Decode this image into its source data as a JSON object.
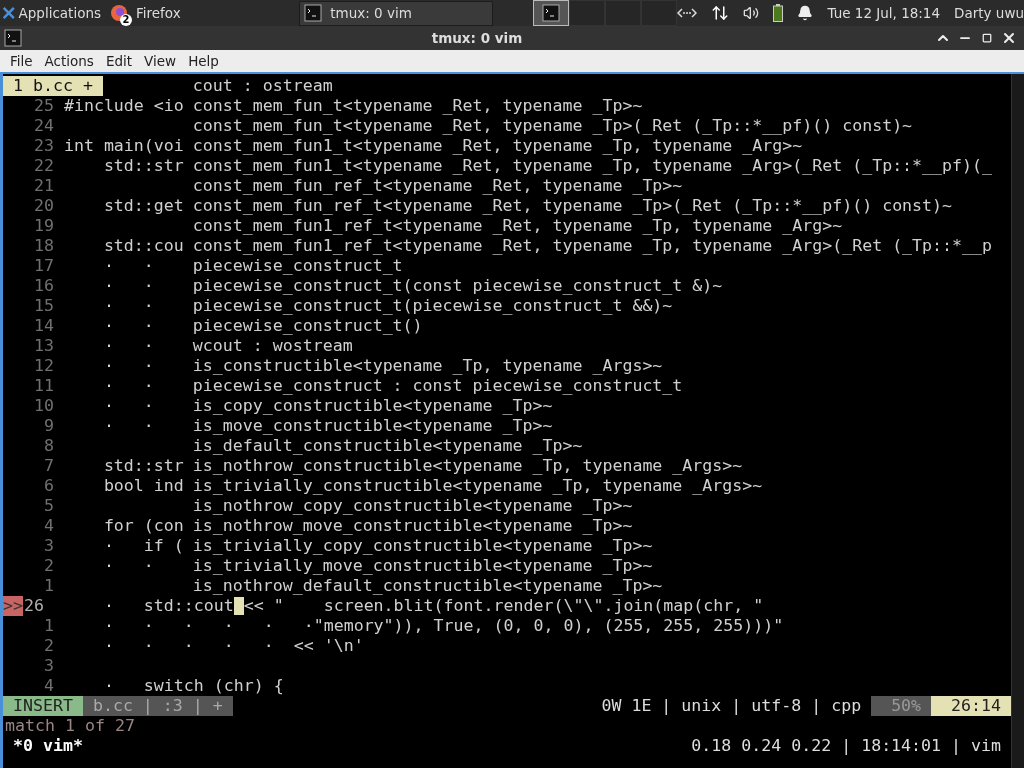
{
  "taskbar": {
    "menu_label": "Applications",
    "tasks": [
      {
        "label": "Firefox",
        "badge": "2",
        "kind": "browser",
        "selected": false
      },
      {
        "label": "tmux: 0 vim",
        "kind": "terminal",
        "selected": true
      }
    ],
    "workspaces": [
      {
        "selected": true
      },
      {
        "selected": false
      },
      {
        "selected": false
      },
      {
        "selected": false
      }
    ],
    "clock": "Tue 12 Jul, 18:14",
    "user": "Darty uwu"
  },
  "window": {
    "title": "tmux: 0 vim"
  },
  "menu": [
    "File",
    "Actions",
    "Edit",
    "View",
    "Help"
  ],
  "vim": {
    "tab": "1 b.cc +",
    "lines": [
      {
        "num": "25",
        "code": "#include <io",
        "current": false
      },
      {
        "num": "24",
        "current": false
      },
      {
        "num": "23",
        "code": "int main(voi",
        "current": false
      },
      {
        "num": "22",
        "code": "    std::str",
        "current": false
      },
      {
        "num": "21",
        "current": false
      },
      {
        "num": "20",
        "code": "    std::get",
        "current": false
      },
      {
        "num": "19",
        "current": false
      },
      {
        "num": "18",
        "code": "    std::cou",
        "current": false
      },
      {
        "num": "17",
        "code": "    ·   ·",
        "current": false
      },
      {
        "num": "16",
        "code": "    ·   ·",
        "current": false
      },
      {
        "num": "15",
        "code": "    ·   ·",
        "current": false
      },
      {
        "num": "14",
        "code": "    ·   ·",
        "current": false
      },
      {
        "num": "13",
        "code": "    ·   ·",
        "current": false
      },
      {
        "num": "12",
        "code": "    ·   ·",
        "current": false
      },
      {
        "num": "11",
        "code": "    ·   ·",
        "current": false
      },
      {
        "num": "10",
        "code": "    ·   ·",
        "current": false
      },
      {
        "num": "9",
        "code": "    ·   ·",
        "current": false
      },
      {
        "num": "8",
        "current": false
      },
      {
        "num": "7",
        "code": "    std::str",
        "current": false
      },
      {
        "num": "6",
        "code": "    bool ind",
        "current": false
      },
      {
        "num": "5",
        "current": false
      },
      {
        "num": "4",
        "code": "    for (con",
        "current": false
      },
      {
        "num": "3",
        "code": "    ·   if (",
        "current": false
      },
      {
        "num": "2",
        "code": "    ·   ·",
        "current": false
      },
      {
        "num": "1",
        "current": false
      },
      {
        "num": "26",
        "sign": ">>",
        "code": "    ·   std::cout",
        "after": "<< \"    screen.blit(font.render(\\\"\\\".join(map(chr, \"",
        "current": true
      },
      {
        "num": "1",
        "code": "    ·   ·   ·   ·   ·   ·\"memory\")), True, (0, 0, 0), (255, 255, 255)))\"",
        "current": false
      },
      {
        "num": "2",
        "code": "    ·   ·   ·   ·   ·  << '\\n'",
        "current": false
      },
      {
        "num": "3",
        "current": false
      },
      {
        "num": "4",
        "code": "    ·   switch (chr) {",
        "current": false
      }
    ],
    "completions": [
      "cout : ostream",
      "const_mem_fun_t<typename _Ret, typename _Tp>~",
      "const_mem_fun_t<typename _Ret, typename _Tp>(_Ret (_Tp::*__pf)() const)~",
      "const_mem_fun1_t<typename _Ret, typename _Tp, typename _Arg>~",
      "const_mem_fun1_t<typename _Ret, typename _Tp, typename _Arg>(_Ret (_Tp::*__pf)(_",
      "const_mem_fun_ref_t<typename _Ret, typename _Tp>~",
      "const_mem_fun_ref_t<typename _Ret, typename _Tp>(_Ret (_Tp::*__pf)() const)~",
      "const_mem_fun1_ref_t<typename _Ret, typename _Tp, typename _Arg>~",
      "const_mem_fun1_ref_t<typename _Ret, typename _Tp, typename _Arg>(_Ret (_Tp::*__p",
      "piecewise_construct_t",
      "piecewise_construct_t(const piecewise_construct_t &)~",
      "piecewise_construct_t(piecewise_construct_t &&)~",
      "piecewise_construct_t()",
      "wcout : wostream",
      "is_constructible<typename _Tp, typename _Args>~",
      "piecewise_construct : const piecewise_construct_t",
      "is_copy_constructible<typename _Tp>~",
      "is_move_constructible<typename _Tp>~",
      "is_default_constructible<typename _Tp>~",
      "is_nothrow_constructible<typename _Tp, typename _Args>~",
      "is_trivially_constructible<typename _Tp, typename _Args>~",
      "is_nothrow_copy_constructible<typename _Tp>~",
      "is_nothrow_move_constructible<typename _Tp>~",
      "is_trivially_copy_constructible<typename _Tp>~",
      "is_trivially_move_constructible<typename _Tp>~",
      "is_nothrow_default_constructible<typename _Tp>~"
    ],
    "statusline": {
      "mode": "INSERT",
      "file": "b.cc | :3 | +",
      "info": "0W 1E | unix | utf-8 | cpp",
      "percent": "50%",
      "position": "26:14"
    },
    "message": "match 1 of 27"
  },
  "tmux": {
    "window": "*0 vim*",
    "status": "0.18 0.24 0.22 | 18:14:01 | vim"
  }
}
